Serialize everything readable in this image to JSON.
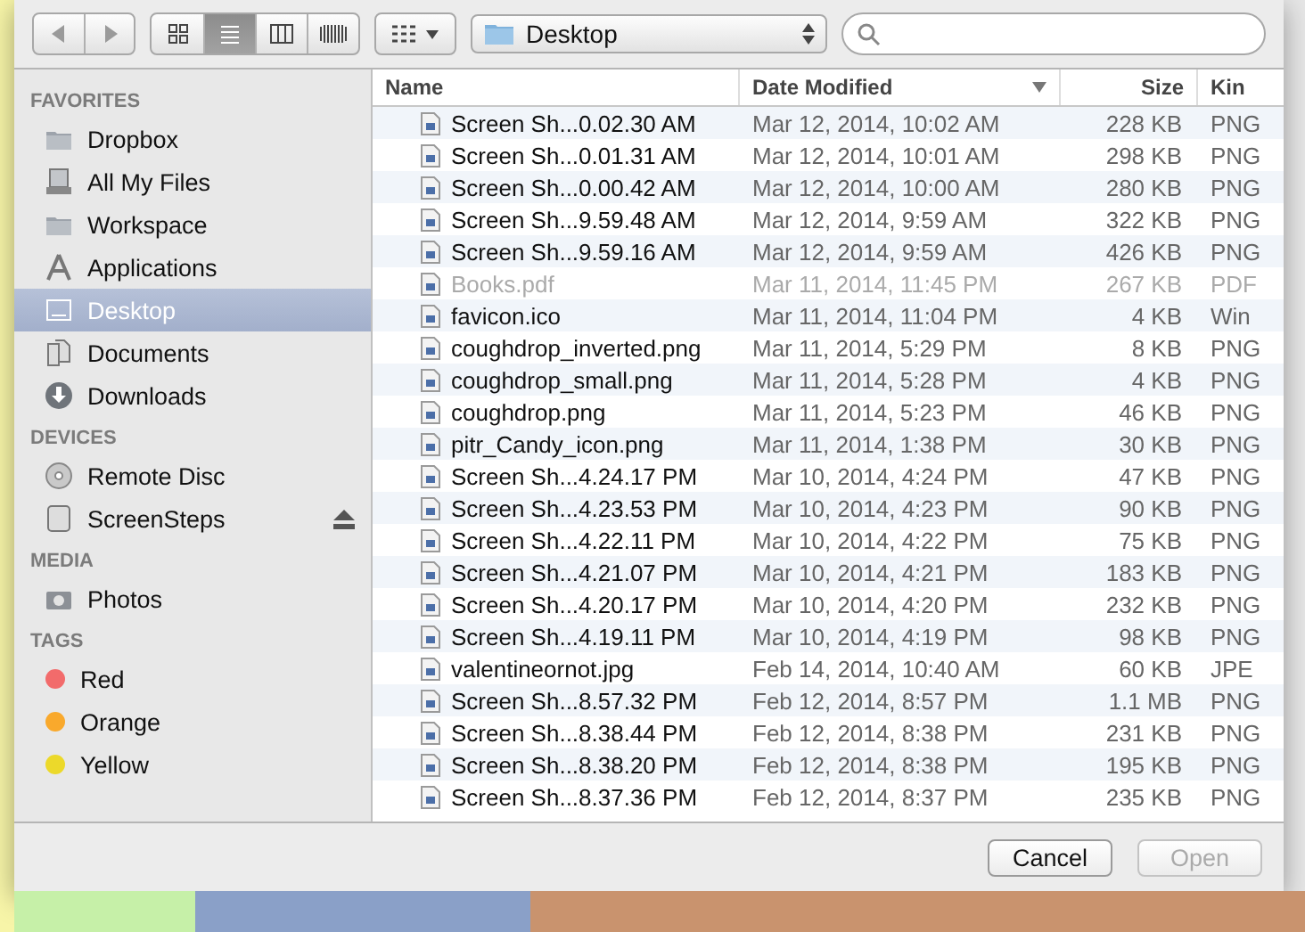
{
  "toolbar": {
    "views": [
      {
        "selected": false
      },
      {
        "selected": true
      },
      {
        "selected": false
      },
      {
        "selected": false
      }
    ],
    "location": "Desktop"
  },
  "sidebar": [
    {
      "title": "FAVORITES",
      "items": [
        {
          "label": "Dropbox",
          "kind": "folder",
          "selected": false
        },
        {
          "label": "All My Files",
          "kind": "files",
          "selected": false
        },
        {
          "label": "Workspace",
          "kind": "folder",
          "selected": false
        },
        {
          "label": "Applications",
          "kind": "apps",
          "selected": false
        },
        {
          "label": "Desktop",
          "kind": "desktop",
          "selected": true
        },
        {
          "label": "Documents",
          "kind": "documents",
          "selected": false
        },
        {
          "label": "Downloads",
          "kind": "downloads",
          "selected": false
        }
      ]
    },
    {
      "title": "DEVICES",
      "items": [
        {
          "label": "Remote Disc",
          "kind": "disc",
          "selected": false
        },
        {
          "label": "ScreenSteps",
          "kind": "drive",
          "selected": false,
          "ejectable": true
        }
      ]
    },
    {
      "title": "MEDIA",
      "items": [
        {
          "label": "Photos",
          "kind": "photos",
          "selected": false
        }
      ]
    },
    {
      "title": "TAGS",
      "items": [
        {
          "label": "Red",
          "kind": "tag",
          "color": "#f26b6b",
          "selected": false
        },
        {
          "label": "Orange",
          "kind": "tag",
          "color": "#f9a92c",
          "selected": false
        },
        {
          "label": "Yellow",
          "kind": "tag",
          "color": "#ecd92a",
          "selected": false
        }
      ]
    }
  ],
  "table": {
    "columns": [
      {
        "label": "Name",
        "sorted": false
      },
      {
        "label": "Date Modified",
        "sorted": true
      },
      {
        "label": "Size",
        "sorted": false
      },
      {
        "label": "Kin",
        "sorted": false
      }
    ],
    "rows": [
      {
        "name": "Screen Sh...0.02.30 AM",
        "date": "Mar 12, 2014, 10:02 AM",
        "size": "228 KB",
        "kind": "PNG",
        "disabled": false
      },
      {
        "name": "Screen Sh...0.01.31 AM",
        "date": "Mar 12, 2014, 10:01 AM",
        "size": "298 KB",
        "kind": "PNG",
        "disabled": false
      },
      {
        "name": "Screen Sh...0.00.42 AM",
        "date": "Mar 12, 2014, 10:00 AM",
        "size": "280 KB",
        "kind": "PNG",
        "disabled": false
      },
      {
        "name": "Screen Sh...9.59.48 AM",
        "date": "Mar 12, 2014, 9:59 AM",
        "size": "322 KB",
        "kind": "PNG",
        "disabled": false
      },
      {
        "name": "Screen Sh...9.59.16 AM",
        "date": "Mar 12, 2014, 9:59 AM",
        "size": "426 KB",
        "kind": "PNG",
        "disabled": false
      },
      {
        "name": "Books.pdf",
        "date": "Mar 11, 2014, 11:45 PM",
        "size": "267 KB",
        "kind": "PDF",
        "disabled": true
      },
      {
        "name": "favicon.ico",
        "date": "Mar 11, 2014, 11:04 PM",
        "size": "4 KB",
        "kind": "Win",
        "disabled": false
      },
      {
        "name": "coughdrop_inverted.png",
        "date": "Mar 11, 2014, 5:29 PM",
        "size": "8 KB",
        "kind": "PNG",
        "disabled": false
      },
      {
        "name": "coughdrop_small.png",
        "date": "Mar 11, 2014, 5:28 PM",
        "size": "4 KB",
        "kind": "PNG",
        "disabled": false
      },
      {
        "name": "coughdrop.png",
        "date": "Mar 11, 2014, 5:23 PM",
        "size": "46 KB",
        "kind": "PNG",
        "disabled": false
      },
      {
        "name": "pitr_Candy_icon.png",
        "date": "Mar 11, 2014, 1:38 PM",
        "size": "30 KB",
        "kind": "PNG",
        "disabled": false
      },
      {
        "name": "Screen Sh...4.24.17 PM",
        "date": "Mar 10, 2014, 4:24 PM",
        "size": "47 KB",
        "kind": "PNG",
        "disabled": false
      },
      {
        "name": "Screen Sh...4.23.53 PM",
        "date": "Mar 10, 2014, 4:23 PM",
        "size": "90 KB",
        "kind": "PNG",
        "disabled": false
      },
      {
        "name": "Screen Sh...4.22.11 PM",
        "date": "Mar 10, 2014, 4:22 PM",
        "size": "75 KB",
        "kind": "PNG",
        "disabled": false
      },
      {
        "name": "Screen Sh...4.21.07 PM",
        "date": "Mar 10, 2014, 4:21 PM",
        "size": "183 KB",
        "kind": "PNG",
        "disabled": false
      },
      {
        "name": "Screen Sh...4.20.17 PM",
        "date": "Mar 10, 2014, 4:20 PM",
        "size": "232 KB",
        "kind": "PNG",
        "disabled": false
      },
      {
        "name": "Screen Sh...4.19.11 PM",
        "date": "Mar 10, 2014, 4:19 PM",
        "size": "98 KB",
        "kind": "PNG",
        "disabled": false
      },
      {
        "name": "valentineornot.jpg",
        "date": "Feb 14, 2014, 10:40 AM",
        "size": "60 KB",
        "kind": "JPE",
        "disabled": false
      },
      {
        "name": "Screen Sh...8.57.32 PM",
        "date": "Feb 12, 2014, 8:57 PM",
        "size": "1.1 MB",
        "kind": "PNG",
        "disabled": false
      },
      {
        "name": "Screen Sh...8.38.44 PM",
        "date": "Feb 12, 2014, 8:38 PM",
        "size": "231 KB",
        "kind": "PNG",
        "disabled": false
      },
      {
        "name": "Screen Sh...8.38.20 PM",
        "date": "Feb 12, 2014, 8:38 PM",
        "size": "195 KB",
        "kind": "PNG",
        "disabled": false
      },
      {
        "name": "Screen Sh...8.37.36 PM",
        "date": "Feb 12, 2014, 8:37 PM",
        "size": "235 KB",
        "kind": "PNG",
        "disabled": false
      }
    ]
  },
  "buttons": [
    {
      "label": "Cancel",
      "disabled": false
    },
    {
      "label": "Open",
      "disabled": true
    }
  ]
}
